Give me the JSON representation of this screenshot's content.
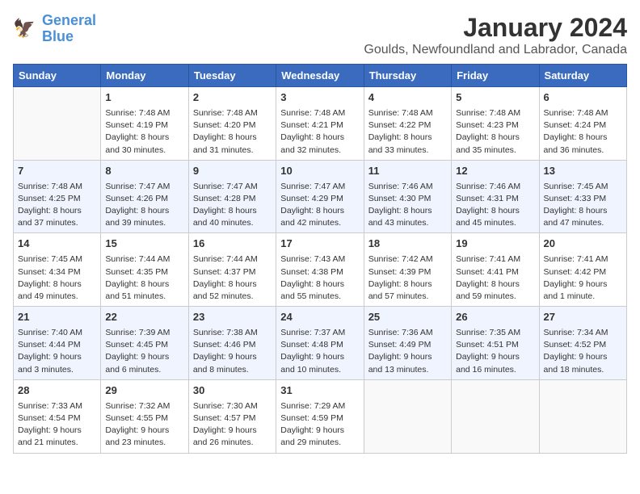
{
  "logo": {
    "line1": "General",
    "line2": "Blue"
  },
  "title": "January 2024",
  "location": "Goulds, Newfoundland and Labrador, Canada",
  "weekdays": [
    "Sunday",
    "Monday",
    "Tuesday",
    "Wednesday",
    "Thursday",
    "Friday",
    "Saturday"
  ],
  "weeks": [
    [
      {
        "day": "",
        "info": ""
      },
      {
        "day": "1",
        "info": "Sunrise: 7:48 AM\nSunset: 4:19 PM\nDaylight: 8 hours\nand 30 minutes."
      },
      {
        "day": "2",
        "info": "Sunrise: 7:48 AM\nSunset: 4:20 PM\nDaylight: 8 hours\nand 31 minutes."
      },
      {
        "day": "3",
        "info": "Sunrise: 7:48 AM\nSunset: 4:21 PM\nDaylight: 8 hours\nand 32 minutes."
      },
      {
        "day": "4",
        "info": "Sunrise: 7:48 AM\nSunset: 4:22 PM\nDaylight: 8 hours\nand 33 minutes."
      },
      {
        "day": "5",
        "info": "Sunrise: 7:48 AM\nSunset: 4:23 PM\nDaylight: 8 hours\nand 35 minutes."
      },
      {
        "day": "6",
        "info": "Sunrise: 7:48 AM\nSunset: 4:24 PM\nDaylight: 8 hours\nand 36 minutes."
      }
    ],
    [
      {
        "day": "7",
        "info": "Sunrise: 7:48 AM\nSunset: 4:25 PM\nDaylight: 8 hours\nand 37 minutes."
      },
      {
        "day": "8",
        "info": "Sunrise: 7:47 AM\nSunset: 4:26 PM\nDaylight: 8 hours\nand 39 minutes."
      },
      {
        "day": "9",
        "info": "Sunrise: 7:47 AM\nSunset: 4:28 PM\nDaylight: 8 hours\nand 40 minutes."
      },
      {
        "day": "10",
        "info": "Sunrise: 7:47 AM\nSunset: 4:29 PM\nDaylight: 8 hours\nand 42 minutes."
      },
      {
        "day": "11",
        "info": "Sunrise: 7:46 AM\nSunset: 4:30 PM\nDaylight: 8 hours\nand 43 minutes."
      },
      {
        "day": "12",
        "info": "Sunrise: 7:46 AM\nSunset: 4:31 PM\nDaylight: 8 hours\nand 45 minutes."
      },
      {
        "day": "13",
        "info": "Sunrise: 7:45 AM\nSunset: 4:33 PM\nDaylight: 8 hours\nand 47 minutes."
      }
    ],
    [
      {
        "day": "14",
        "info": "Sunrise: 7:45 AM\nSunset: 4:34 PM\nDaylight: 8 hours\nand 49 minutes."
      },
      {
        "day": "15",
        "info": "Sunrise: 7:44 AM\nSunset: 4:35 PM\nDaylight: 8 hours\nand 51 minutes."
      },
      {
        "day": "16",
        "info": "Sunrise: 7:44 AM\nSunset: 4:37 PM\nDaylight: 8 hours\nand 52 minutes."
      },
      {
        "day": "17",
        "info": "Sunrise: 7:43 AM\nSunset: 4:38 PM\nDaylight: 8 hours\nand 55 minutes."
      },
      {
        "day": "18",
        "info": "Sunrise: 7:42 AM\nSunset: 4:39 PM\nDaylight: 8 hours\nand 57 minutes."
      },
      {
        "day": "19",
        "info": "Sunrise: 7:41 AM\nSunset: 4:41 PM\nDaylight: 8 hours\nand 59 minutes."
      },
      {
        "day": "20",
        "info": "Sunrise: 7:41 AM\nSunset: 4:42 PM\nDaylight: 9 hours\nand 1 minute."
      }
    ],
    [
      {
        "day": "21",
        "info": "Sunrise: 7:40 AM\nSunset: 4:44 PM\nDaylight: 9 hours\nand 3 minutes."
      },
      {
        "day": "22",
        "info": "Sunrise: 7:39 AM\nSunset: 4:45 PM\nDaylight: 9 hours\nand 6 minutes."
      },
      {
        "day": "23",
        "info": "Sunrise: 7:38 AM\nSunset: 4:46 PM\nDaylight: 9 hours\nand 8 minutes."
      },
      {
        "day": "24",
        "info": "Sunrise: 7:37 AM\nSunset: 4:48 PM\nDaylight: 9 hours\nand 10 minutes."
      },
      {
        "day": "25",
        "info": "Sunrise: 7:36 AM\nSunset: 4:49 PM\nDaylight: 9 hours\nand 13 minutes."
      },
      {
        "day": "26",
        "info": "Sunrise: 7:35 AM\nSunset: 4:51 PM\nDaylight: 9 hours\nand 16 minutes."
      },
      {
        "day": "27",
        "info": "Sunrise: 7:34 AM\nSunset: 4:52 PM\nDaylight: 9 hours\nand 18 minutes."
      }
    ],
    [
      {
        "day": "28",
        "info": "Sunrise: 7:33 AM\nSunset: 4:54 PM\nDaylight: 9 hours\nand 21 minutes."
      },
      {
        "day": "29",
        "info": "Sunrise: 7:32 AM\nSunset: 4:55 PM\nDaylight: 9 hours\nand 23 minutes."
      },
      {
        "day": "30",
        "info": "Sunrise: 7:30 AM\nSunset: 4:57 PM\nDaylight: 9 hours\nand 26 minutes."
      },
      {
        "day": "31",
        "info": "Sunrise: 7:29 AM\nSunset: 4:59 PM\nDaylight: 9 hours\nand 29 minutes."
      },
      {
        "day": "",
        "info": ""
      },
      {
        "day": "",
        "info": ""
      },
      {
        "day": "",
        "info": ""
      }
    ]
  ]
}
